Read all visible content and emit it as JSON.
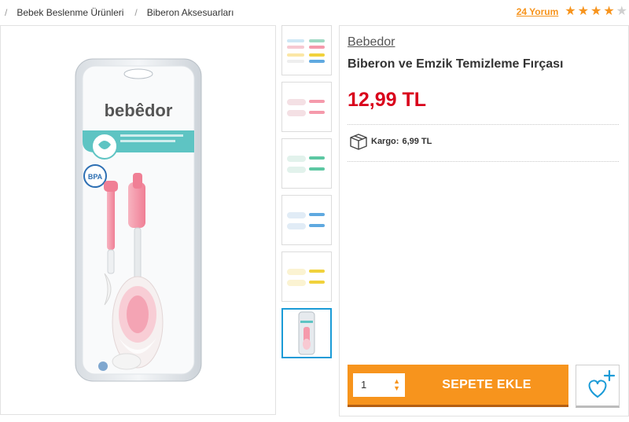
{
  "breadcrumb": {
    "items": [
      "Bebek Beslenme Ürünleri",
      "Biberon Aksesuarları"
    ]
  },
  "reviews": {
    "label": "24 Yorum",
    "rating": 4,
    "max_rating": 5
  },
  "product": {
    "brand": "Bebedor",
    "title": "Biberon ve Emzik Temizleme Fırçası",
    "price": "12,99 TL",
    "package_brand": "bebêdor",
    "cargo_label": "Kargo:",
    "cargo_value": "6,99 TL"
  },
  "cart": {
    "quantity": "1",
    "add_label": "SEPETE EKLE"
  },
  "thumbnails": [
    {
      "variant": "multi",
      "active": false
    },
    {
      "variant": "pink",
      "active": false
    },
    {
      "variant": "green",
      "active": false
    },
    {
      "variant": "blue",
      "active": false
    },
    {
      "variant": "yellow",
      "active": false
    },
    {
      "variant": "package",
      "active": true
    }
  ],
  "colors": {
    "accent_orange": "#f7941d",
    "price_red": "#d9001b",
    "active_blue": "#1a9bd7",
    "pink": "#f59aab",
    "green": "#5cc7a2",
    "blue": "#5fa9e0",
    "yellow": "#f1d23c"
  },
  "icons": {
    "star": "star-icon",
    "cargo": "box-icon",
    "favorite": "heart-plus-icon"
  }
}
